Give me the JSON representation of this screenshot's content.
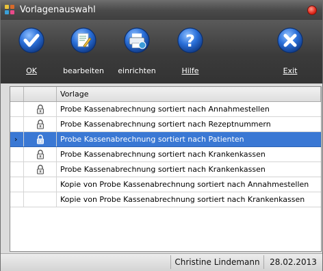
{
  "window": {
    "title": "Vorlagenauswahl",
    "accent": "#3a78d4"
  },
  "toolbar": {
    "buttons": [
      {
        "label": "OK",
        "icon": "checkmark-icon"
      },
      {
        "label": "bearbeiten",
        "icon": "edit-document-icon"
      },
      {
        "label": "einrichten",
        "icon": "printer-setup-icon"
      },
      {
        "label": "Hilfe",
        "icon": "help-icon"
      },
      {
        "label": "Exit",
        "icon": "close-x-icon"
      }
    ]
  },
  "grid": {
    "header": "Vorlage",
    "rows": [
      {
        "text": "Probe Kassenabrechnung sortiert nach Annahmestellen",
        "locked": true,
        "selected": false
      },
      {
        "text": "Probe Kassenabrechnung sortiert nach Rezeptnummern",
        "locked": true,
        "selected": false
      },
      {
        "text": "Probe Kassenabrechnung sortiert nach Patienten",
        "locked": true,
        "selected": true
      },
      {
        "text": "Probe Kassenabrechnung sortiert nach Krankenkassen",
        "locked": true,
        "selected": false
      },
      {
        "text": "Probe Kassenabrechnung sortiert nach Krankenkassen",
        "locked": true,
        "selected": false
      },
      {
        "text": "Kopie von Probe Kassenabrechnung sortiert nach Annahmestellen",
        "locked": false,
        "selected": false
      },
      {
        "text": "Kopie von Probe Kassenabrechnung sortiert nach Krankenkassen",
        "locked": false,
        "selected": false
      }
    ],
    "row_indicator": "›"
  },
  "statusbar": {
    "user": "Christine Lindemann",
    "date": "28.02.2013"
  }
}
